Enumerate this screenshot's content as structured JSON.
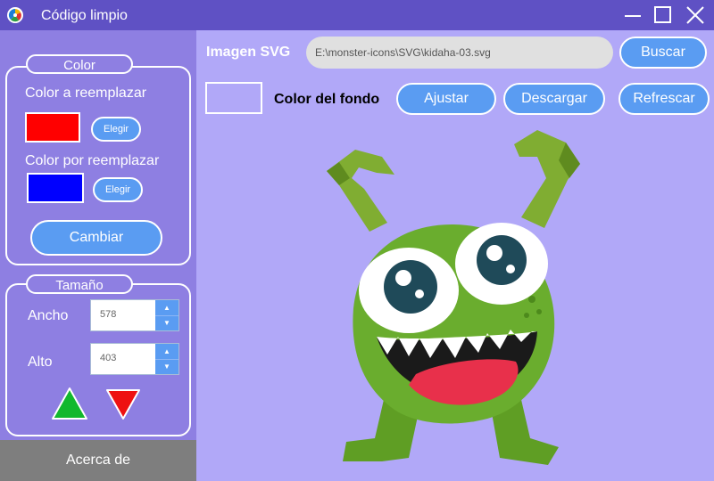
{
  "window": {
    "title": "Código limpio",
    "icons": {
      "app": "app-logo-icon",
      "minimize": "minimize-icon",
      "maximize": "maximize-icon",
      "close": "close-icon"
    }
  },
  "sidebar": {
    "color_group": {
      "title": "Color",
      "replace_label": "Color a reemplazar",
      "replace_color": "#ff0000",
      "replace_pick_label": "Elegir",
      "with_label": "Color por reemplazar",
      "with_color": "#0000ff",
      "with_pick_label": "Elegir",
      "change_button": "Cambiar"
    },
    "size_group": {
      "title": "Tamaño",
      "width_label": "Ancho",
      "width_value": "578",
      "height_label": "Alto",
      "height_value": "403",
      "increase_icon": "triangle-up-icon",
      "decrease_icon": "triangle-down-icon"
    },
    "about_button": "Acerca de"
  },
  "main": {
    "svg_label": "Imagen SVG",
    "path_value": "E:\\monster-icons\\SVG\\kidaha-03.svg",
    "search_button": "Buscar",
    "bg_color_label": "Color del fondo",
    "bg_color": "#b1a8f8",
    "fit_button": "Ajustar",
    "download_button": "Descargar",
    "refresh_button": "Refrescar",
    "preview": "monster-illustration"
  },
  "colors": {
    "titlebar": "#5f51c4",
    "sidebar": "#8e7fe2",
    "canvas": "#b1a8f8",
    "accent": "#5a9cf2",
    "about": "#7e7e7e"
  }
}
